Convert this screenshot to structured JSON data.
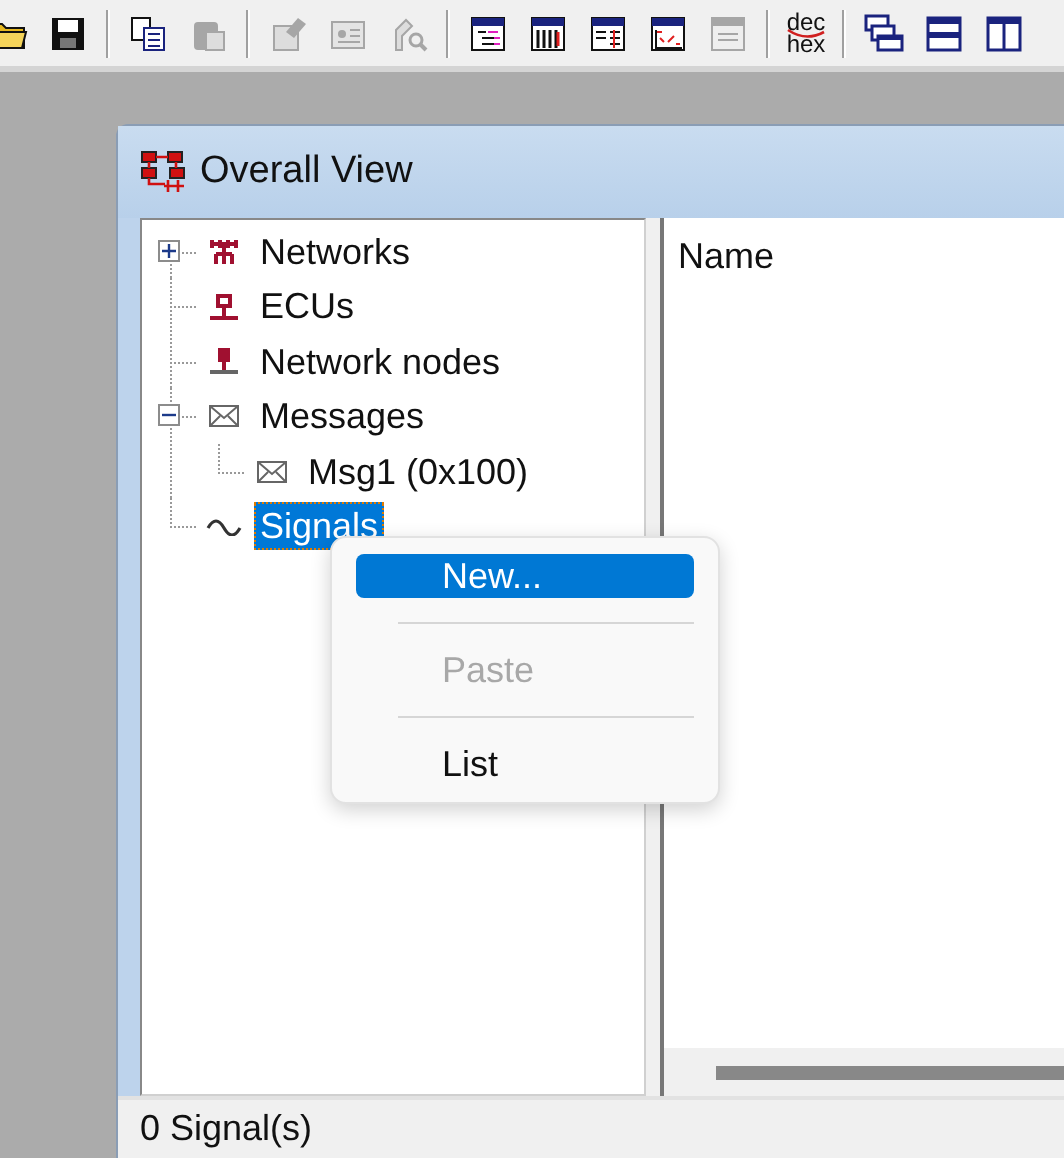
{
  "toolbar": [
    {
      "kind": "button",
      "disabled": false
    },
    {
      "kind": "button",
      "disabled": false
    },
    {
      "kind": "separator"
    },
    {
      "kind": "button",
      "disabled": false
    },
    {
      "kind": "button",
      "disabled": true
    },
    {
      "kind": "separator"
    },
    {
      "kind": "button",
      "disabled": true
    },
    {
      "kind": "button",
      "disabled": true
    },
    {
      "kind": "button",
      "disabled": true
    },
    {
      "kind": "separator"
    },
    {
      "kind": "button",
      "disabled": false
    },
    {
      "kind": "button",
      "disabled": false
    },
    {
      "kind": "button",
      "disabled": false
    },
    {
      "kind": "button",
      "disabled": false
    },
    {
      "kind": "button",
      "disabled": true
    },
    {
      "kind": "separator"
    },
    {
      "kind": "text-button",
      "top": "dec",
      "bottom": "hex",
      "disabled": false
    },
    {
      "kind": "separator"
    },
    {
      "kind": "button",
      "disabled": false
    },
    {
      "kind": "button",
      "disabled": false
    },
    {
      "kind": "button",
      "disabled": false
    }
  ],
  "window": {
    "title": "Overall View"
  },
  "tree": [
    {
      "label": "Networks",
      "expanded": false,
      "selected": false
    },
    {
      "label": "ECUs",
      "selected": false
    },
    {
      "label": "Network nodes",
      "selected": false
    },
    {
      "label": "Messages",
      "expanded": true,
      "selected": false,
      "children": [
        {
          "label": "Msg1 (0x100)",
          "selected": false
        }
      ]
    },
    {
      "label": "Signals",
      "selected": true
    }
  ],
  "list": {
    "columns": [
      "Name"
    ]
  },
  "context_menu": [
    {
      "kind": "item",
      "label": "New...",
      "highlighted": true,
      "disabled": false
    },
    {
      "kind": "separator"
    },
    {
      "kind": "item",
      "label": "Paste",
      "highlighted": false,
      "disabled": true
    },
    {
      "kind": "separator"
    },
    {
      "kind": "item",
      "label": "List",
      "highlighted": false,
      "disabled": false
    }
  ],
  "status_bar": "0 Signal(s)"
}
